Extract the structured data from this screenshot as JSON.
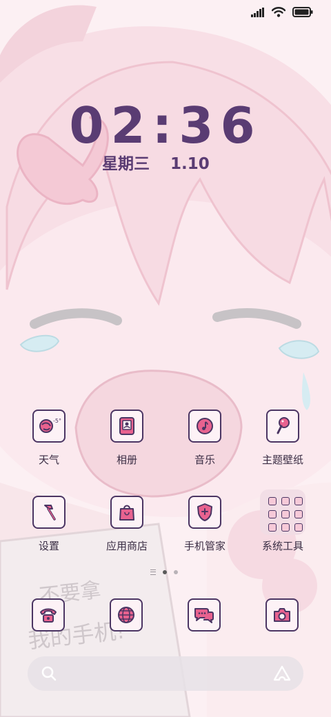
{
  "status_bar": {
    "icons": [
      "signal-icon",
      "wifi-icon",
      "battery-icon"
    ]
  },
  "lock": {
    "time": "02:36",
    "weekday": "星期三",
    "date": "1.10"
  },
  "wallpaper": {
    "handwriting": [
      "不要拿",
      "我的手机!"
    ]
  },
  "weather": {
    "temp": "-5°"
  },
  "apps_row1": [
    {
      "label": "天气",
      "icon": "weather-icon"
    },
    {
      "label": "相册",
      "icon": "gallery-icon"
    },
    {
      "label": "音乐",
      "icon": "music-icon"
    },
    {
      "label": "主题壁纸",
      "icon": "theme-brush-icon"
    }
  ],
  "apps_row2": [
    {
      "label": "设置",
      "icon": "hammer-icon"
    },
    {
      "label": "应用商店",
      "icon": "shopping-bag-icon"
    },
    {
      "label": "手机管家",
      "icon": "shield-plus-icon"
    },
    {
      "label": "系统工具",
      "icon": "folder-icon"
    }
  ],
  "dock": [
    "phone-icon",
    "browser-globe-icon",
    "messages-icon",
    "camera-icon"
  ],
  "colors": {
    "accent": "#e8628f",
    "outline": "#4b3563",
    "clock": "#5a3c73"
  }
}
